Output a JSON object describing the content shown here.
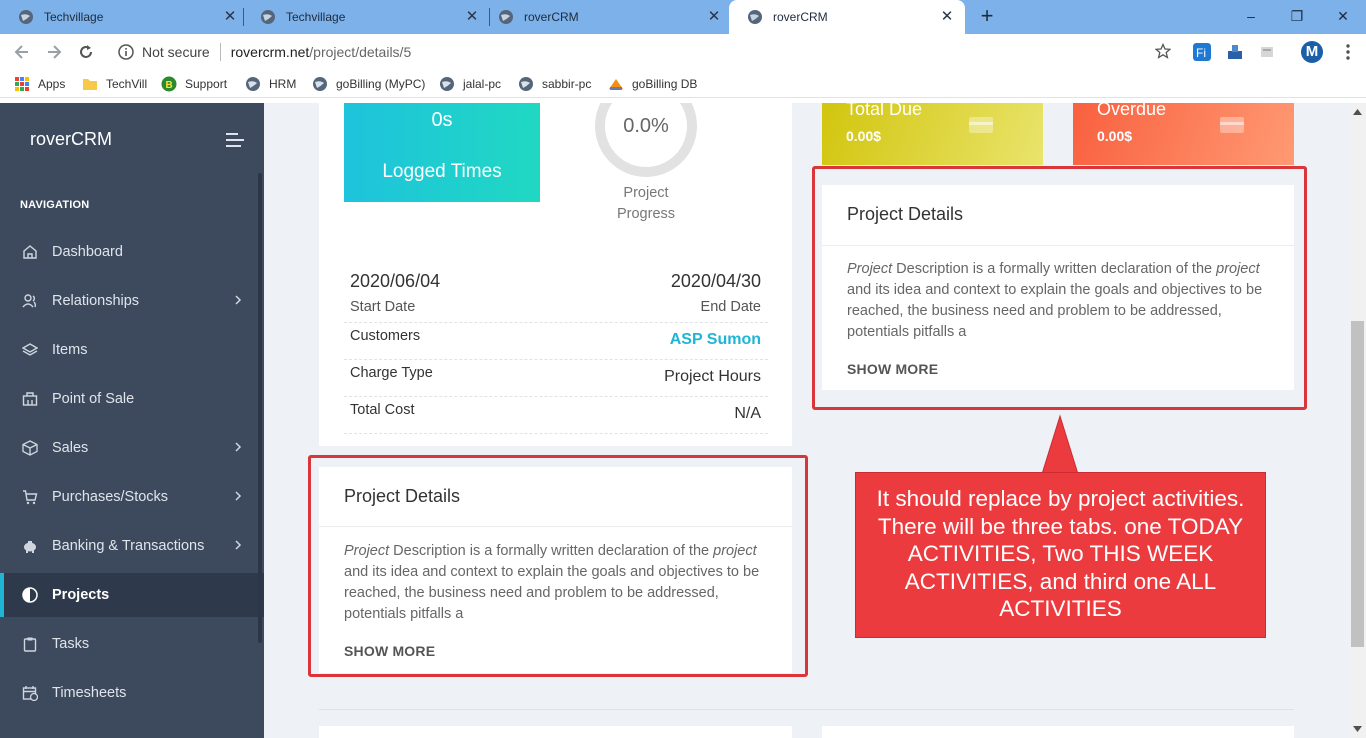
{
  "browser": {
    "tabs": [
      {
        "title": "Techvillage",
        "close": "✕"
      },
      {
        "title": "Techvillage",
        "close": "✕"
      },
      {
        "title": "roverCRM",
        "close": "✕"
      },
      {
        "title": "roverCRM",
        "close": "✕"
      }
    ],
    "new_tab": "+",
    "window_controls": {
      "minimize": "–",
      "restore": "❐",
      "close": "✕"
    },
    "security_label": "Not secure",
    "url_host": "rovercrm.net",
    "url_path": "/project/details/5",
    "profile_initial": "M",
    "bookmarks": [
      "Apps",
      "TechVill",
      "Support",
      "HRM",
      "goBilling (MyPC)",
      "jalal-pc",
      "sabbir-pc",
      "goBilling DB"
    ]
  },
  "sidebar": {
    "brand": "roverCRM",
    "heading": "NAVIGATION",
    "items": [
      {
        "label": "Dashboard",
        "icon": "home-icon"
      },
      {
        "label": "Relationships",
        "icon": "users-icon"
      },
      {
        "label": "Items",
        "icon": "layers-icon"
      },
      {
        "label": "Point of Sale",
        "icon": "register-icon"
      },
      {
        "label": "Sales",
        "icon": "box-icon"
      },
      {
        "label": "Purchases/Stocks",
        "icon": "cart-icon"
      },
      {
        "label": "Banking & Transactions",
        "icon": "piggy-bank-icon"
      },
      {
        "label": "Projects",
        "icon": "half-circle-icon"
      },
      {
        "label": "Tasks",
        "icon": "clipboard-icon"
      },
      {
        "label": "Timesheets",
        "icon": "calendar-clock-icon"
      }
    ]
  },
  "overview": {
    "logged_value": "0s",
    "logged_label": "Logged Times",
    "progress_value": "0.0%",
    "progress_label_1": "Project",
    "progress_label_2": "Progress",
    "start_date": "2020/06/04",
    "start_label": "Start Date",
    "end_date": "2020/04/30",
    "end_label": "End Date",
    "customers_label": "Customers",
    "customers_value": "ASP Sumon",
    "charge_label": "Charge Type",
    "charge_value": "Project Hours",
    "cost_label": "Total Cost",
    "cost_value": "N/A"
  },
  "summary_cards": {
    "total_due_title": "Total Due",
    "total_due_value": "0.00$",
    "overdue_title": "Overdue",
    "overdue_value": "0.00$"
  },
  "project_details": {
    "title": "Project Details",
    "desc_em_1": "Project",
    "desc_1": " Description is a formally written declaration of the ",
    "desc_em_2": "project",
    "desc_2": " and its idea and context to explain the goals and objectives to be reached, the business need and problem to be addressed, potentials pitfalls a",
    "show_more": "SHOW MORE"
  },
  "annotation": {
    "text": "It should replace by project activities. There will be three tabs. one TODAY ACTIVITIES, Two THIS WEEK ACTIVITIES, and third one ALL ACTIVITIES",
    "colors": {
      "box": "#ec3b3f",
      "outline": "#d9353b"
    }
  }
}
